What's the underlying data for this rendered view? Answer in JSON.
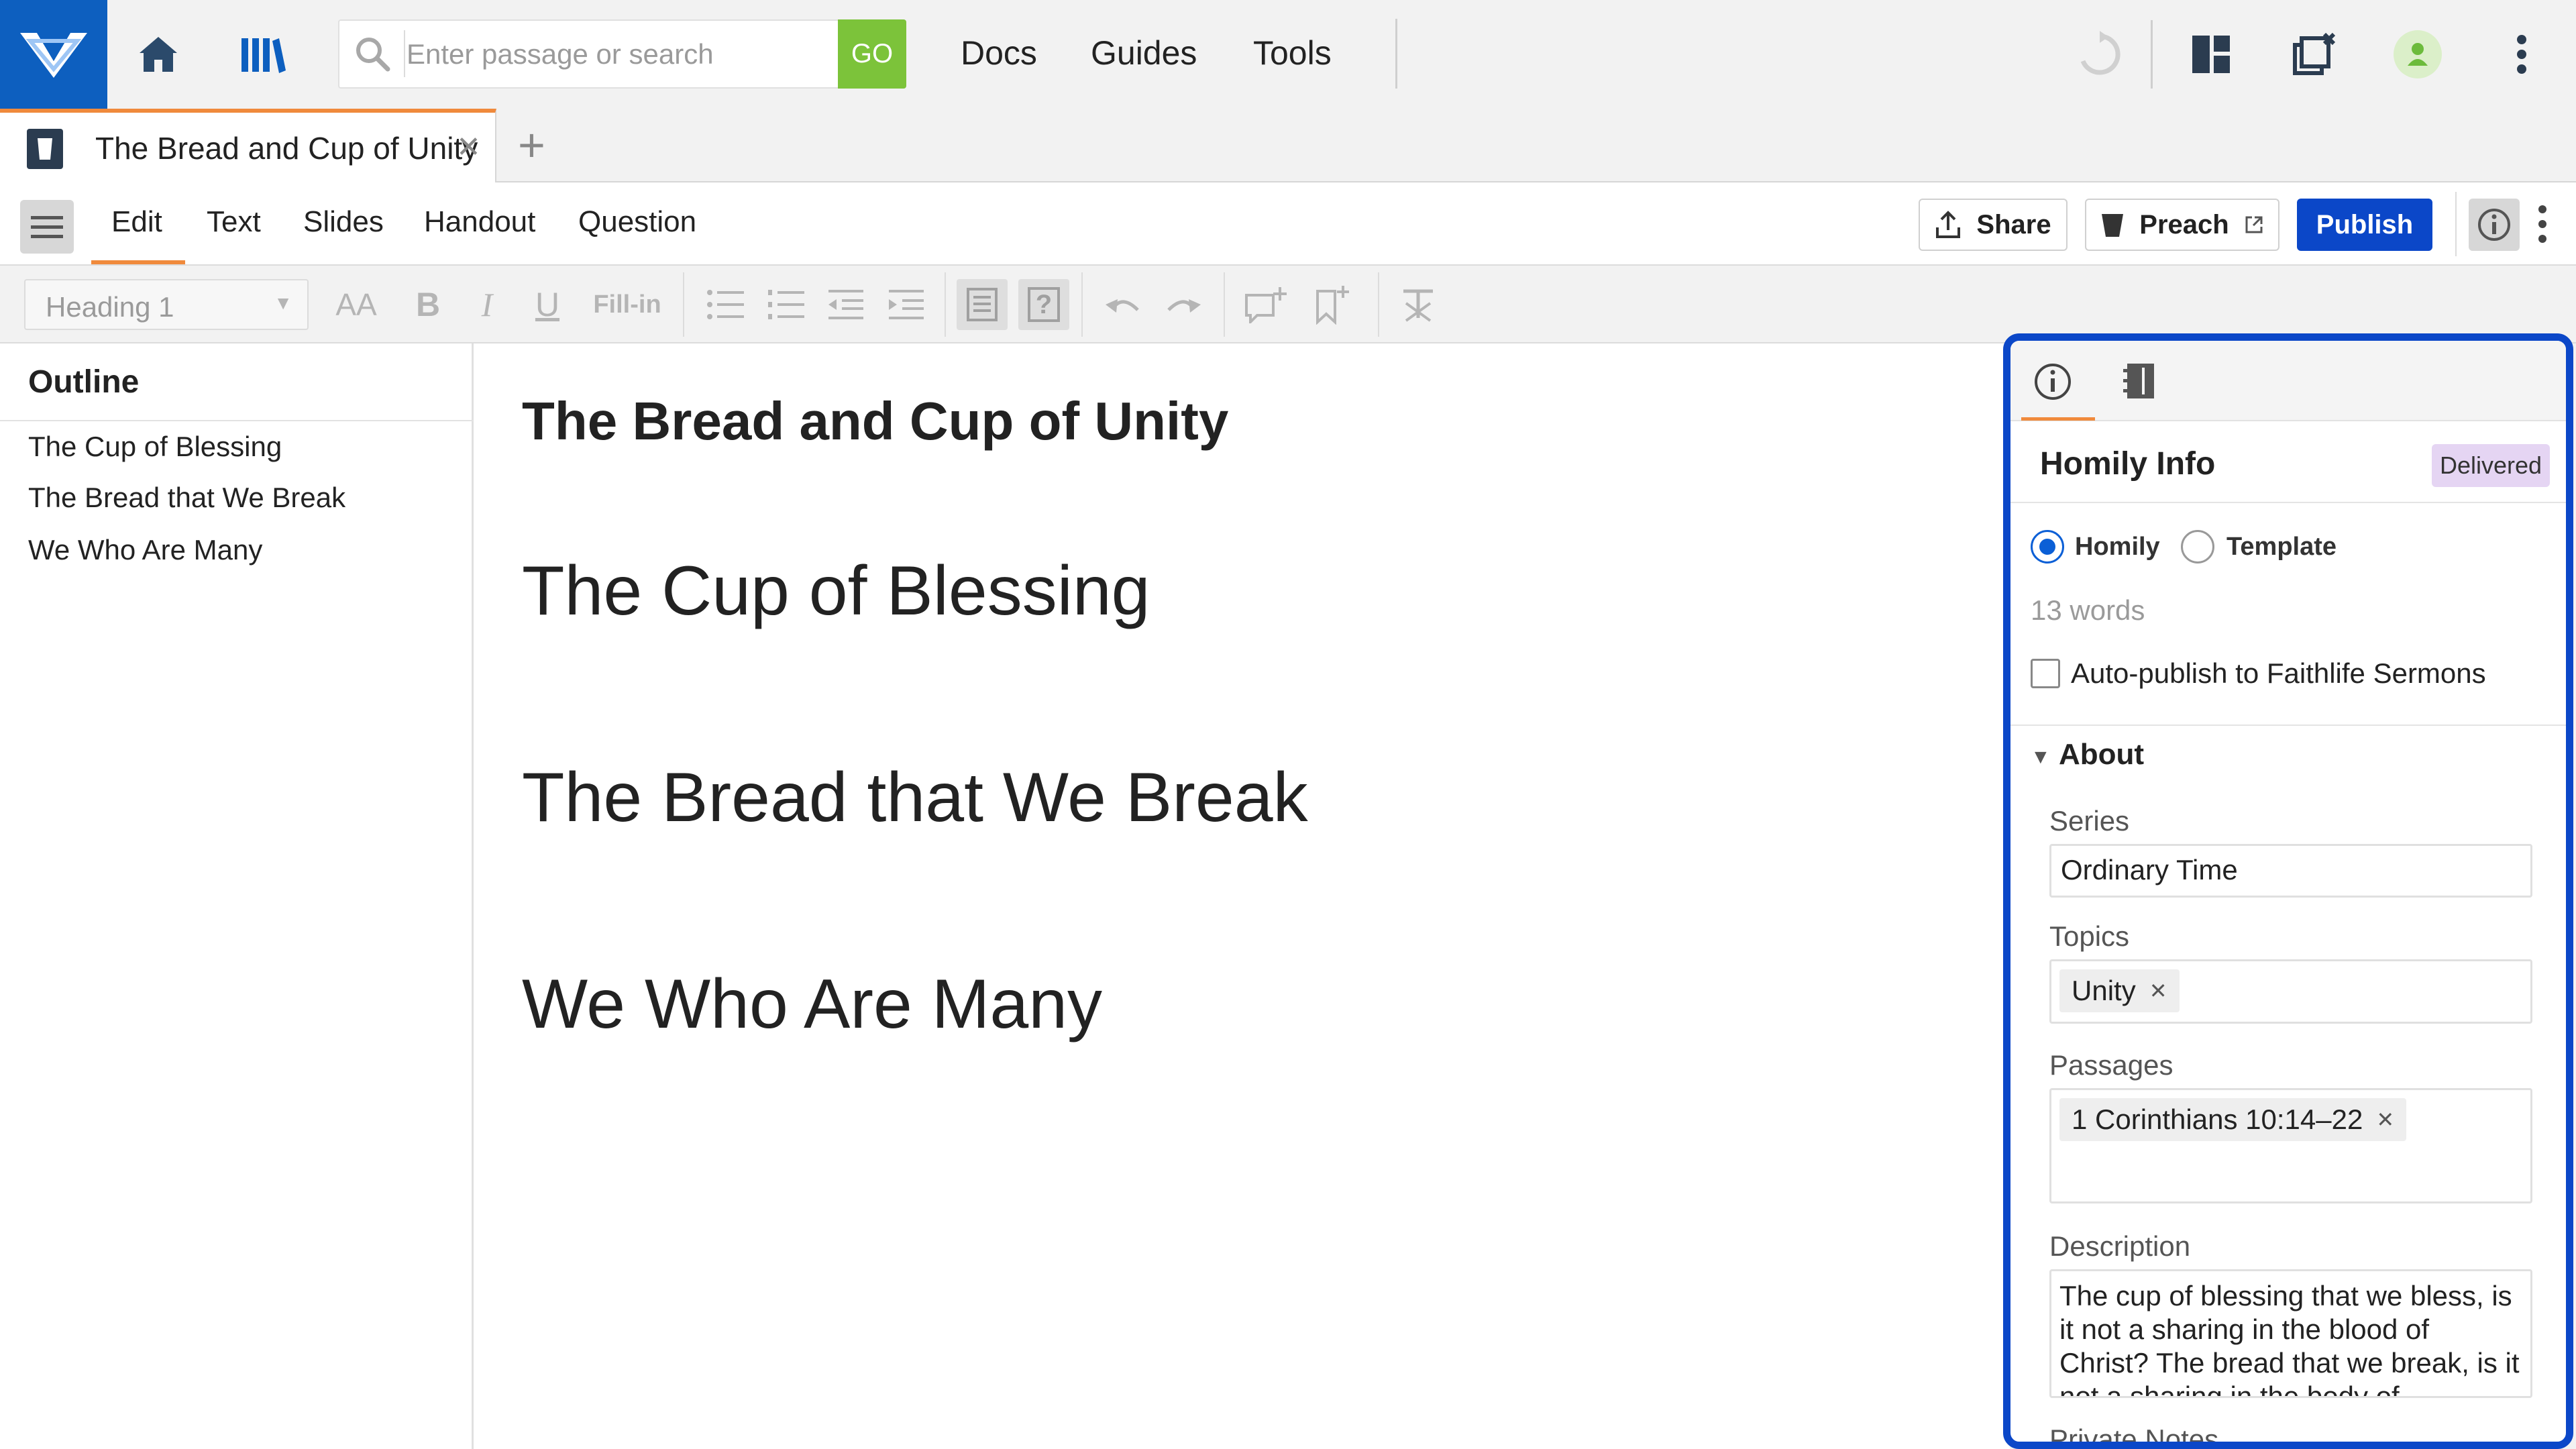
{
  "colors": {
    "brand_blue": "#0d5fbf",
    "go_green": "#7cc33a",
    "accent_orange": "#f08a3c",
    "publish_blue": "#0b47c8",
    "panel_border": "#0b47c8",
    "badge_purple": "#e5d5f3"
  },
  "topbar": {
    "icons": [
      "app-logo-icon",
      "home-icon",
      "library-icon",
      "search-icon",
      "sync-icon",
      "layout-icon",
      "close-windows-icon",
      "user-icon",
      "more-vertical-icon"
    ],
    "search": {
      "placeholder": "Enter passage or search",
      "value": "",
      "go_label": "GO"
    },
    "nav": [
      "Docs",
      "Guides",
      "Tools"
    ]
  },
  "tabs": {
    "active": {
      "title": "The Bread and Cup of Unity",
      "icon": "sermon-doc-icon"
    },
    "add_label": "+"
  },
  "toolbar": {
    "menu_icon": "hamburger-icon",
    "tabs": [
      "Edit",
      "Text",
      "Slides",
      "Handout",
      "Question"
    ],
    "active_tab": "Edit",
    "share_label": "Share",
    "preach_label": "Preach",
    "publish_label": "Publish"
  },
  "format": {
    "heading_value": "Heading 1",
    "fillin_label": "Fill-in",
    "bold": "B",
    "italic": "I",
    "underline": "U",
    "font_size": "AA"
  },
  "outline": {
    "title": "Outline",
    "items": [
      "The Cup of Blessing",
      "The Bread that We Break",
      "We Who Are Many"
    ]
  },
  "editor": {
    "title": "The Bread and Cup of Unity",
    "headings": [
      "The Cup of Blessing",
      "The Bread that We Break",
      "We Who Are Many"
    ]
  },
  "panel": {
    "title": "Homily Info",
    "badge": "Delivered",
    "radio_homily": "Homily",
    "radio_template": "Template",
    "selected_type": "Homily",
    "word_count": "13 words",
    "autopublish_label": "Auto-publish to Faithlife Sermons",
    "autopublish_checked": false,
    "about_label": "About",
    "series_label": "Series",
    "series_value": "Ordinary Time",
    "topics_label": "Topics",
    "topics": [
      "Unity"
    ],
    "passages_label": "Passages",
    "passages": [
      "1 Corinthians 10:14–22"
    ],
    "description_label": "Description",
    "description_value": "The cup of blessing that we bless, is it not a sharing in the blood of Christ? The bread that we break, is it not a sharing in the body of",
    "private_notes_label": "Private Notes"
  }
}
